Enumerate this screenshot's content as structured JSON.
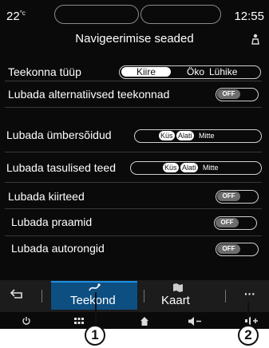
{
  "status": {
    "temperature": "22",
    "temperature_unit": "°c",
    "time": "12:55"
  },
  "header": {
    "title": "Navigeerimise seaded"
  },
  "settings": {
    "route_type": {
      "label": "Teekonna tüüp",
      "options": [
        "Kiire",
        "Öko",
        "Lühike"
      ],
      "selected": "Kiire"
    },
    "alt_routes": {
      "label": "Lubada alternatiivsed teekonnad",
      "state": "OFF"
    },
    "detours": {
      "label": "Lubada ümbersõidud",
      "options": [
        "Küs",
        "Alati",
        "Mitte"
      ]
    },
    "toll_roads": {
      "label": "Lubada tasulised teed",
      "options": [
        "Küs",
        "Alati",
        "Mitte"
      ]
    },
    "highways": {
      "label": "Lubada kiirteed",
      "state": "OFF"
    },
    "ferries": {
      "label": "Lubada praamid",
      "state": "OFF"
    },
    "car_trains": {
      "label": "Lubada autorongid",
      "state": "OFF"
    }
  },
  "tabs": {
    "route": "Teekond",
    "map": "Kaart",
    "more": "···"
  },
  "callouts": [
    "1",
    "2"
  ],
  "colors": {
    "active_tab": "#0e4f82",
    "background": "#0a0a0a"
  }
}
